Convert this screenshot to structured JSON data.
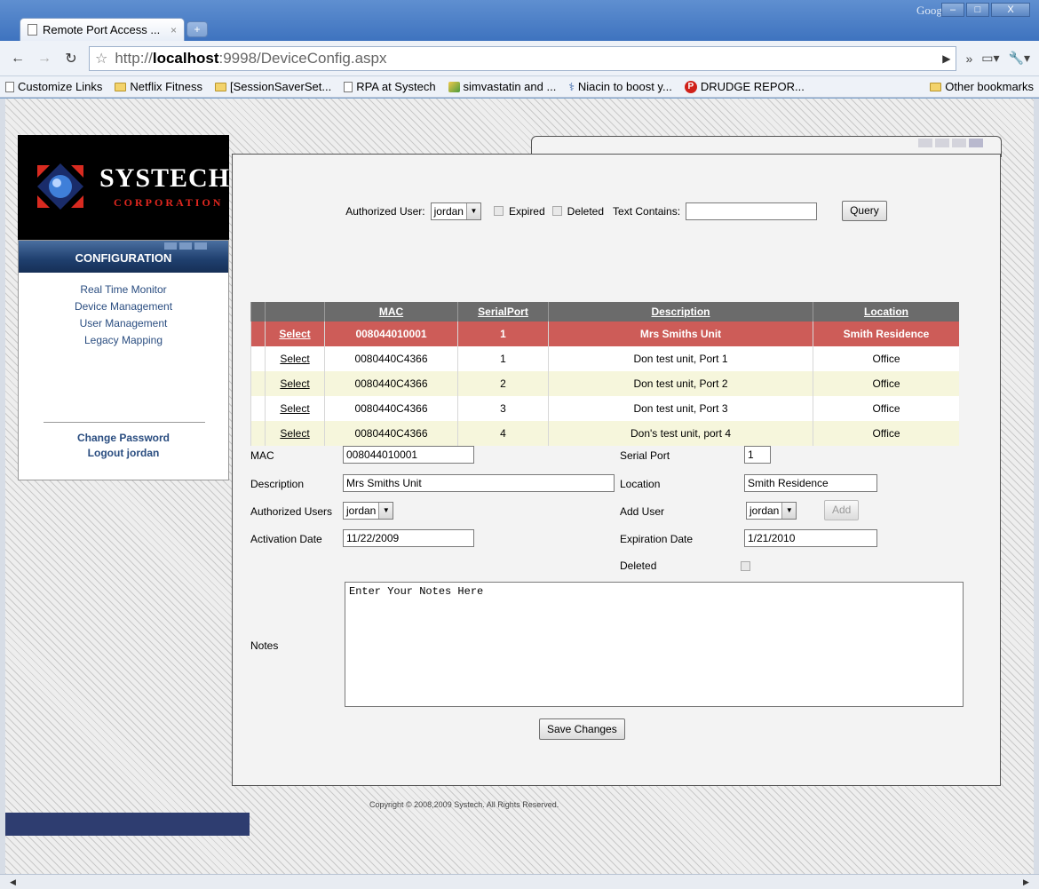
{
  "browser": {
    "tab_title": "Remote Port Access ...",
    "tab_close": "×",
    "new_tab": "+",
    "corner_brand": "Google",
    "window_buttons": {
      "minimize": "–",
      "maximize": "□",
      "close": "X"
    },
    "url": {
      "proto": "http://",
      "host": "localhost",
      "rest": ":9998/DeviceConfig.aspx"
    },
    "bookmarks": [
      "Customize Links",
      "Netflix Fitness",
      "[SessionSaverSet...",
      "RPA at Systech",
      "simvastatin and ...",
      "Niacin to boost y...",
      "DRUDGE REPOR..."
    ],
    "other_bookmarks": "Other bookmarks"
  },
  "logo": {
    "name": "SYSTECH",
    "sub": "CORPORATION"
  },
  "sidebar": {
    "header": "CONFIGURATION",
    "links": [
      "Real Time Monitor",
      "Device Management",
      "User Management",
      "Legacy Mapping"
    ],
    "change_password": "Change Password",
    "logout": "Logout jordan"
  },
  "filter": {
    "authorized_user_label": "Authorized User:",
    "authorized_user_value": "jordan",
    "expired_label": "Expired",
    "deleted_label": "Deleted",
    "text_contains_label": "Text Contains:",
    "text_contains_value": "",
    "query_button": "Query"
  },
  "table": {
    "headers": [
      "MAC",
      "SerialPort",
      "Description",
      "Location"
    ],
    "select_label": "Select",
    "rows": [
      {
        "mac": "008044010001",
        "port": "1",
        "description": "Mrs Smiths Unit",
        "location": "Smith Residence",
        "selected": true
      },
      {
        "mac": "0080440C4366",
        "port": "1",
        "description": "Don test unit, Port 1",
        "location": "Office",
        "selected": false
      },
      {
        "mac": "0080440C4366",
        "port": "2",
        "description": "Don test unit, Port 2",
        "location": "Office",
        "selected": false
      },
      {
        "mac": "0080440C4366",
        "port": "3",
        "description": "Don test unit, Port 3",
        "location": "Office",
        "selected": false
      },
      {
        "mac": "0080440C4366",
        "port": "4",
        "description": "Don's test unit, port 4",
        "location": "Office",
        "selected": false
      }
    ]
  },
  "form": {
    "mac_label": "MAC",
    "mac_value": "008044010001",
    "serial_port_label": "Serial Port",
    "serial_port_value": "1",
    "description_label": "Description",
    "description_value": "Mrs Smiths Unit",
    "location_label": "Location",
    "location_value": "Smith Residence",
    "authorized_users_label": "Authorized Users",
    "authorized_users_value": "jordan",
    "add_user_label": "Add User",
    "add_user_value": "jordan",
    "add_button": "Add",
    "activation_date_label": "Activation Date",
    "activation_date_value": "11/22/2009",
    "expiration_date_label": "Expiration Date",
    "expiration_date_value": "1/21/2010",
    "deleted_label": "Deleted",
    "notes_label": "Notes",
    "notes_value": "Enter Your Notes Here",
    "save_button": "Save Changes"
  },
  "footer": {
    "copyright": "Copyright © 2008,2009 Systech. All Rights Reserved."
  },
  "colors": {
    "selected_row": "#cd5c58",
    "header_row": "#6b6b6b",
    "alt_row": "#f6f6dc",
    "nav_dark": "#1f3f6e"
  }
}
